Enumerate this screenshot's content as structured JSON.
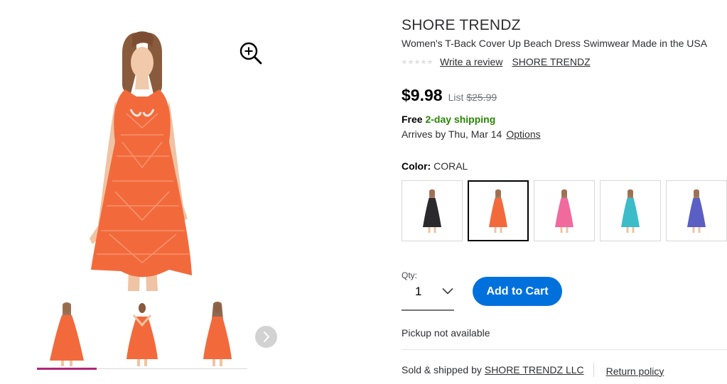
{
  "product": {
    "brand": "SHORE TRENDZ",
    "title": "Women's T-Back Cover Up Beach Dress Swimwear Made in the USA",
    "rating_stars": 5,
    "rating_filled": 0,
    "write_review_label": "Write a review",
    "brand_link_label": "SHORE TRENDZ"
  },
  "pricing": {
    "price": "$9.98",
    "list_label": "List",
    "list_price": "$25.99"
  },
  "shipping": {
    "free_label": "Free",
    "shipping_type": "2-day shipping",
    "arrives_text": "Arrives by Thu, Mar 14",
    "options_label": "Options"
  },
  "color": {
    "label": "Color:",
    "selected_value": "CORAL",
    "swatches": [
      {
        "name": "Black",
        "hex": "#2a2a2e"
      },
      {
        "name": "Coral",
        "hex": "#f26a3c"
      },
      {
        "name": "Pink",
        "hex": "#f06a9e"
      },
      {
        "name": "Aqua",
        "hex": "#3bbcc8"
      },
      {
        "name": "Purple",
        "hex": "#5b5fc4"
      }
    ],
    "selected_index": 1
  },
  "quantity": {
    "label": "Qty:",
    "value": "1"
  },
  "cart": {
    "add_label": "Add to Cart"
  },
  "fulfillment": {
    "pickup_text": "Pickup not available",
    "sold_by_prefix": "Sold & shipped by",
    "seller_name": "SHORE TRENDZ LLC",
    "return_policy_label": "Return policy"
  },
  "gallery": {
    "thumbnail_count": 3,
    "active_index": 0,
    "icons": {
      "zoom": "zoom-in-icon",
      "next": "chevron-right-icon"
    }
  },
  "colors": {
    "accent_blue": "#0071dc",
    "shipping_green": "#2a8703",
    "active_thumb_bar": "#b0267a",
    "dress_coral": "#f26a3c"
  }
}
